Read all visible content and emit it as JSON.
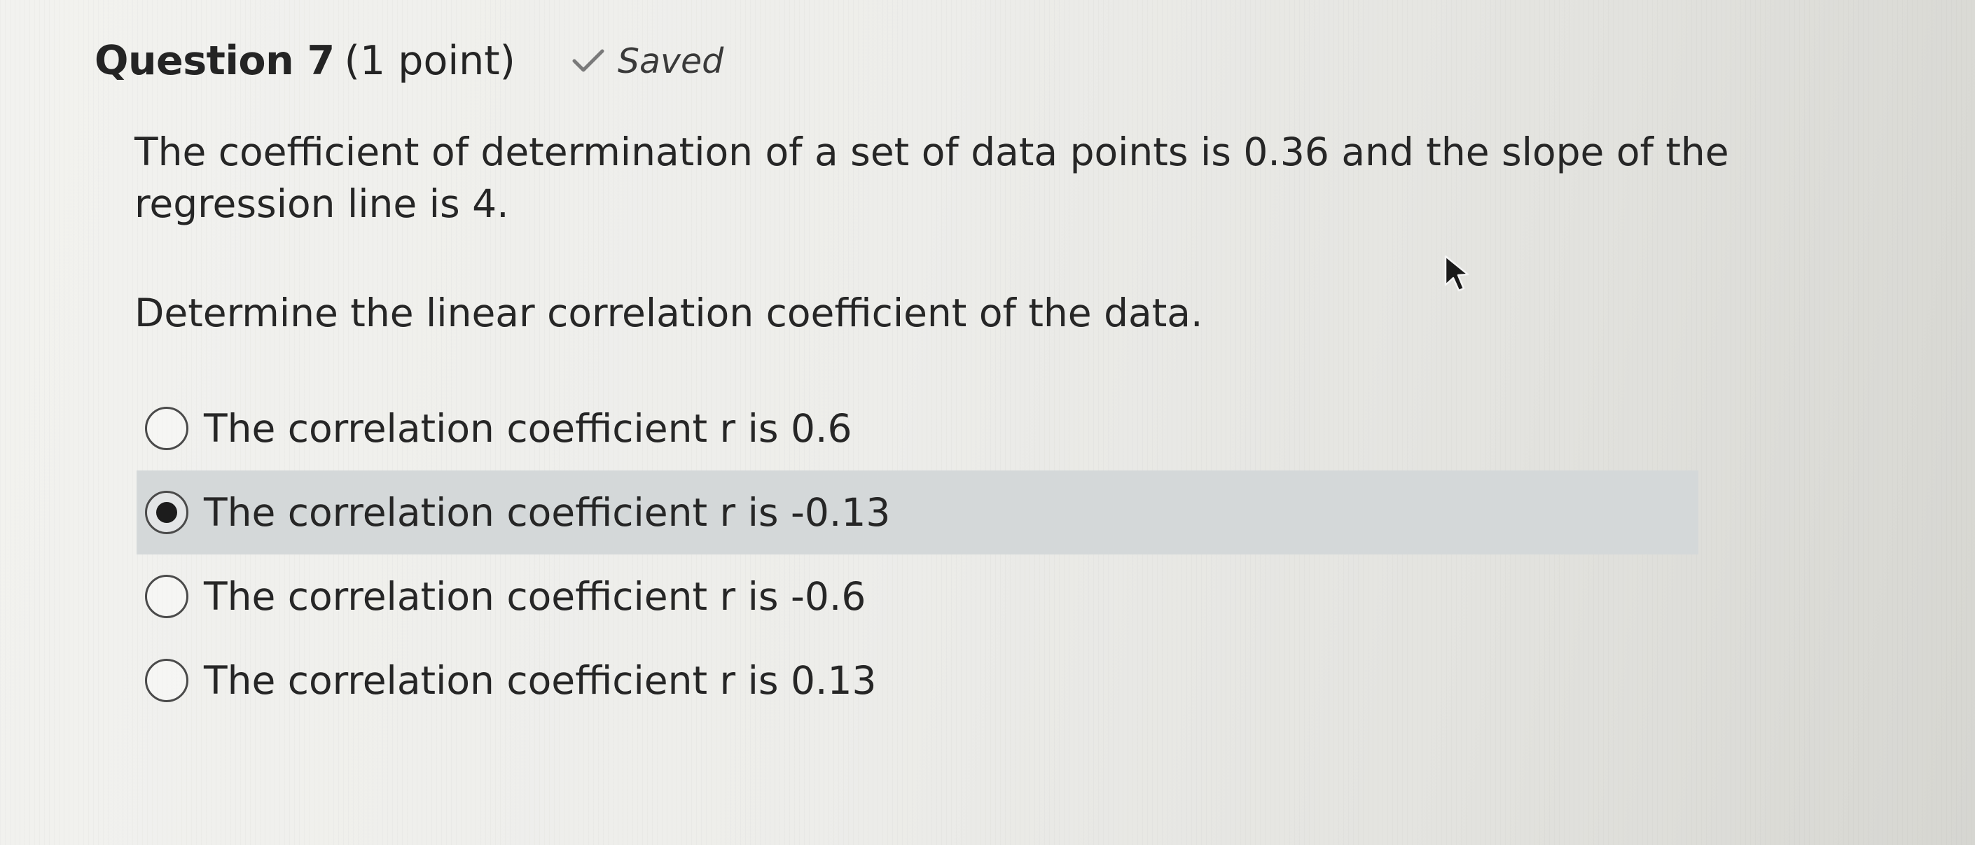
{
  "question": {
    "title": "Question 7",
    "points": "(1 point)",
    "status_icon": "check-icon",
    "status_label": "Saved"
  },
  "prompt": {
    "text": "The coefficient of determination of a set of data points is 0.36 and the slope of the regression line is 4.",
    "instruction": "Determine the linear correlation coefficient of the data."
  },
  "options": [
    {
      "label": "The correlation coefficient r is 0.6",
      "selected": false
    },
    {
      "label": "The correlation coefficient r is -0.13",
      "selected": true
    },
    {
      "label": "The correlation coefficient r is -0.6",
      "selected": false
    },
    {
      "label": "The correlation coefficient r is 0.13",
      "selected": false
    }
  ],
  "colors": {
    "selected_row": "#d4d8d9",
    "text": "#262626",
    "background": "#ededea"
  }
}
